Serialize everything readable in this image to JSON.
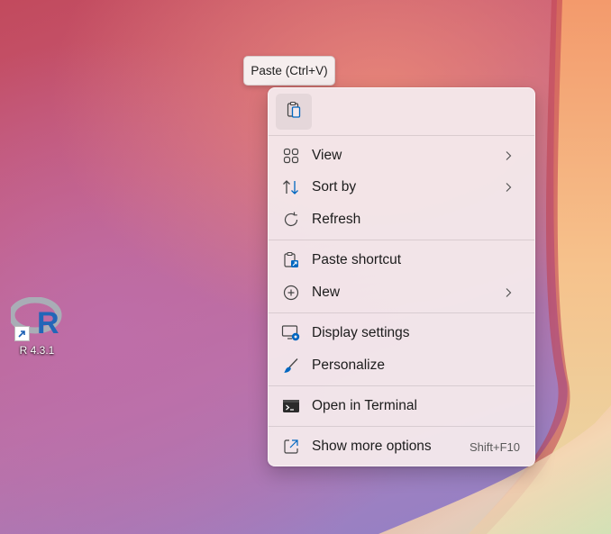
{
  "desktop": {
    "icon_label": "R 4.3.1",
    "icon_name": "r-app-icon"
  },
  "tooltip": {
    "text": "Paste (Ctrl+V)"
  },
  "menu": {
    "quick_actions": [
      {
        "icon": "paste-icon"
      }
    ],
    "items": [
      {
        "label": "View",
        "icon": "grid-icon",
        "has_submenu": true
      },
      {
        "label": "Sort by",
        "icon": "sort-icon",
        "has_submenu": true
      },
      {
        "label": "Refresh",
        "icon": "refresh-icon",
        "has_submenu": false
      },
      {
        "label": "Paste shortcut",
        "icon": "paste-shortcut-icon",
        "has_submenu": false
      },
      {
        "label": "New",
        "icon": "plus-circle-icon",
        "has_submenu": true
      },
      {
        "label": "Display settings",
        "icon": "display-settings-icon",
        "has_submenu": false
      },
      {
        "label": "Personalize",
        "icon": "brush-icon",
        "has_submenu": false
      },
      {
        "label": "Open in Terminal",
        "icon": "terminal-icon",
        "has_submenu": false
      },
      {
        "label": "Show more options",
        "icon": "more-options-icon",
        "accelerator": "Shift+F10",
        "has_submenu": false
      }
    ]
  },
  "colors": {
    "accent": "#0067c0",
    "menu_bg": "#f4e8eb"
  }
}
